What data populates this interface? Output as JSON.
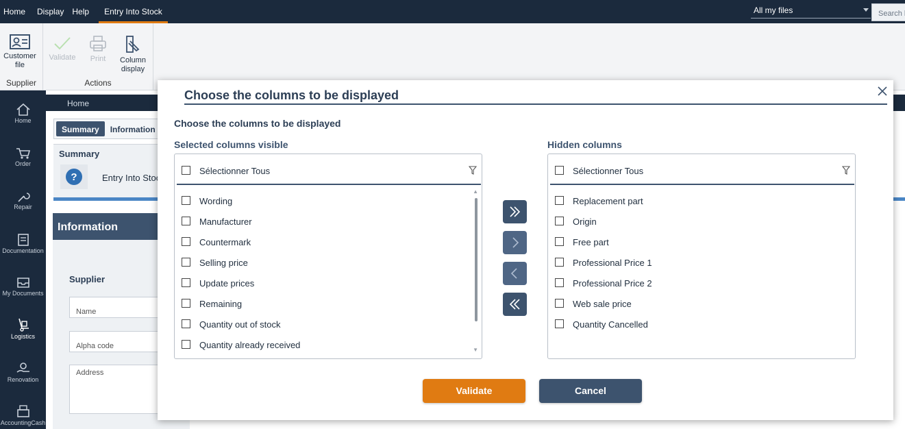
{
  "topbar": {
    "menu": [
      "Home",
      "Display",
      "Help",
      "Entry Into Stock"
    ],
    "active_menu": "Entry Into Stock",
    "files_select": "All my files",
    "search_placeholder": "Search l"
  },
  "ribbon": {
    "supplier_group": {
      "label": "Supplier",
      "customer_file": "Customer file"
    },
    "actions_group": {
      "label": "Actions",
      "validate": "Validate",
      "print": "Print",
      "column_display": "Column display"
    }
  },
  "sidebar": {
    "items": [
      "Home",
      "Order",
      "Repair",
      "Documentation",
      "My Documents",
      "Logistics",
      "Renovation",
      "AccountingCash"
    ]
  },
  "background": {
    "breadcrumb": "Home",
    "tabs": [
      "Summary",
      "Information"
    ],
    "summary_title": "Summary",
    "entry_label": "Entry Into Stoc",
    "info_heading": "Information",
    "supplier_label": "Supplier",
    "fields": [
      "Name",
      "Alpha code",
      "Address"
    ]
  },
  "dialog": {
    "title": "Choose the columns to be displayed",
    "subtitle": "Choose the columns to be displayed",
    "selected": {
      "label": "Selected columns visible",
      "select_all": "Sélectionner Tous",
      "items": [
        "Wording",
        "Manufacturer",
        "Countermark",
        "Selling price",
        "Update prices",
        "Remaining",
        "Quantity out of stock",
        "Quantity already received"
      ]
    },
    "hidden": {
      "label": "Hidden columns",
      "select_all": "Sélectionner Tous",
      "items": [
        "Replacement part",
        "Origin",
        "Free part",
        "Professional Price 1",
        "Professional Price 2",
        "Web sale price",
        "Quantity Cancelled"
      ]
    },
    "validate_label": "Validate",
    "cancel_label": "Cancel"
  },
  "colors": {
    "navy": "#1b2a3d",
    "slate": "#3d536e",
    "accent_orange": "#e07b12",
    "blue_line": "#4a86c5"
  }
}
